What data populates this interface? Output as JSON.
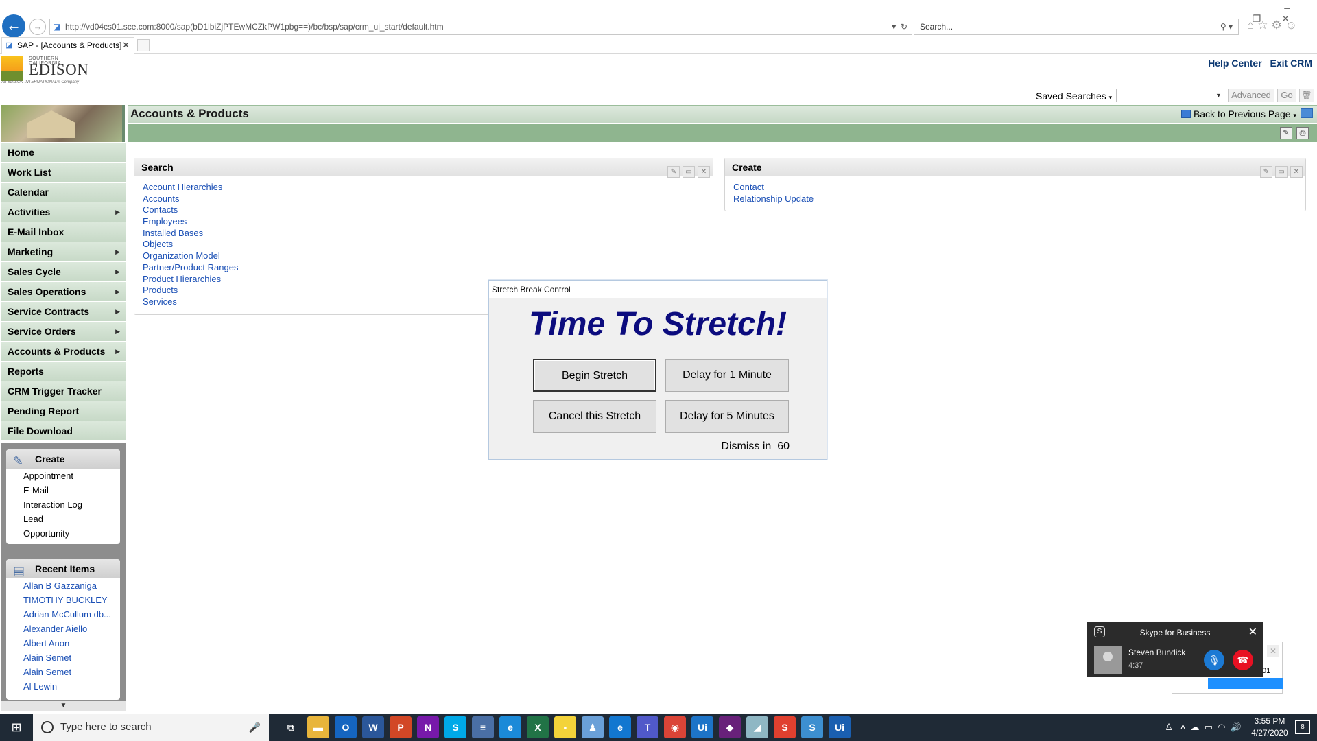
{
  "browser": {
    "url": "http://vd04cs01.sce.com:8000/sap(bD1lbiZjPTEwMCZkPW1pbg==)/bc/bsp/sap/crm_ui_start/default.htm",
    "search_placeholder": "Search...",
    "tab_title": "SAP - [Accounts & Products]"
  },
  "header": {
    "logo": {
      "top_line": "SOUTHERN CALIFORNIA",
      "name": "EDISON",
      "tagline": "An EDISON INTERNATIONAL® Company"
    },
    "help_center": "Help Center",
    "exit_crm": "Exit CRM",
    "saved_searches": "Saved Searches",
    "advanced": "Advanced",
    "go": "Go"
  },
  "nav": {
    "items": [
      {
        "label": "Home",
        "arrow": ""
      },
      {
        "label": "Work List",
        "arrow": ""
      },
      {
        "label": "Calendar",
        "arrow": ""
      },
      {
        "label": "Activities",
        "arrow": "▶"
      },
      {
        "label": "E-Mail Inbox",
        "arrow": ""
      },
      {
        "label": "Marketing",
        "arrow": "▶"
      },
      {
        "label": "Sales Cycle",
        "arrow": "▶"
      },
      {
        "label": "Sales Operations",
        "arrow": "▶"
      },
      {
        "label": "Service Contracts",
        "arrow": "▶"
      },
      {
        "label": "Service Orders",
        "arrow": "▶"
      },
      {
        "label": "Accounts & Products",
        "arrow": "▶"
      },
      {
        "label": "Reports",
        "arrow": ""
      },
      {
        "label": "CRM Trigger Tracker",
        "arrow": ""
      },
      {
        "label": "Pending Report",
        "arrow": ""
      },
      {
        "label": "File Download",
        "arrow": ""
      }
    ],
    "create_box": {
      "title": "Create",
      "items": [
        "Appointment",
        "E-Mail",
        "Interaction Log",
        "Lead",
        "Opportunity"
      ]
    },
    "recent_box": {
      "title": "Recent Items",
      "items": [
        "Allan B Gazzaniga",
        "TIMOTHY BUCKLEY",
        "Adrian McCullum db...",
        "Alexander Aiello",
        "Albert Anon",
        "Alain Semet",
        "Alain Semet",
        "Al Lewin"
      ]
    }
  },
  "main": {
    "title": "Accounts & Products",
    "back_to_previous": "Back to Previous Page",
    "search_panel": {
      "title": "Search",
      "links": [
        "Account Hierarchies",
        "Accounts",
        "Contacts",
        "Employees",
        "Installed Bases",
        "Objects",
        "Organization Model",
        "Partner/Product Ranges",
        "Product Hierarchies",
        "Products",
        "Services"
      ]
    },
    "create_panel": {
      "title": "Create",
      "links": [
        "Contact",
        "Relationship Update"
      ]
    }
  },
  "dialog": {
    "window_title": "Stretch Break Control",
    "heading": "Time To Stretch!",
    "begin": "Begin Stretch",
    "delay1": "Delay for 1 Minute",
    "cancel": "Cancel this Stretch",
    "delay5": "Delay for 5 Minutes",
    "dismiss_label": "Dismiss in",
    "dismiss_seconds": "60"
  },
  "skype": {
    "title": "Skype for Business",
    "contact_name": "Steven Bundick",
    "call_duration": "4:37",
    "behind_time": ":01"
  },
  "taskbar": {
    "search_placeholder": "Type here to search",
    "time": "3:55 PM",
    "date": "4/27/2020",
    "notification_count": "8",
    "apps": [
      {
        "name": "task-view",
        "glyph": "⧉",
        "color": "#1f2a36"
      },
      {
        "name": "file-explorer",
        "glyph": "▬",
        "color": "#e8b53b"
      },
      {
        "name": "outlook",
        "glyph": "O",
        "color": "#1565c0"
      },
      {
        "name": "word",
        "glyph": "W",
        "color": "#2b579a"
      },
      {
        "name": "powerpoint",
        "glyph": "P",
        "color": "#d24726"
      },
      {
        "name": "onenote",
        "glyph": "N",
        "color": "#7719aa"
      },
      {
        "name": "skype",
        "glyph": "S",
        "color": "#00a9e8"
      },
      {
        "name": "app-stripe",
        "glyph": "≡",
        "color": "#4a6fa5"
      },
      {
        "name": "internet-explorer",
        "glyph": "e",
        "color": "#1b8ad8"
      },
      {
        "name": "excel",
        "glyph": "X",
        "color": "#217346"
      },
      {
        "name": "sticky-notes",
        "glyph": "▪",
        "color": "#f3d33a"
      },
      {
        "name": "network-app",
        "glyph": "♟",
        "color": "#6aa0d8"
      },
      {
        "name": "edge",
        "glyph": "e",
        "color": "#1277d0"
      },
      {
        "name": "teams",
        "glyph": "T",
        "color": "#5059c9"
      },
      {
        "name": "chrome",
        "glyph": "◉",
        "color": "#db4437"
      },
      {
        "name": "uipath",
        "glyph": "Ui",
        "color": "#1d74c8"
      },
      {
        "name": "visual-studio",
        "glyph": "◆",
        "color": "#68217a"
      },
      {
        "name": "notes-app",
        "glyph": "◢",
        "color": "#8fb7c4"
      },
      {
        "name": "snagit",
        "glyph": "S",
        "color": "#e0402f"
      },
      {
        "name": "app-s",
        "glyph": "S",
        "color": "#3d8fd0"
      },
      {
        "name": "uipath-studio",
        "glyph": "Ui",
        "color": "#1a5fb0"
      }
    ]
  }
}
